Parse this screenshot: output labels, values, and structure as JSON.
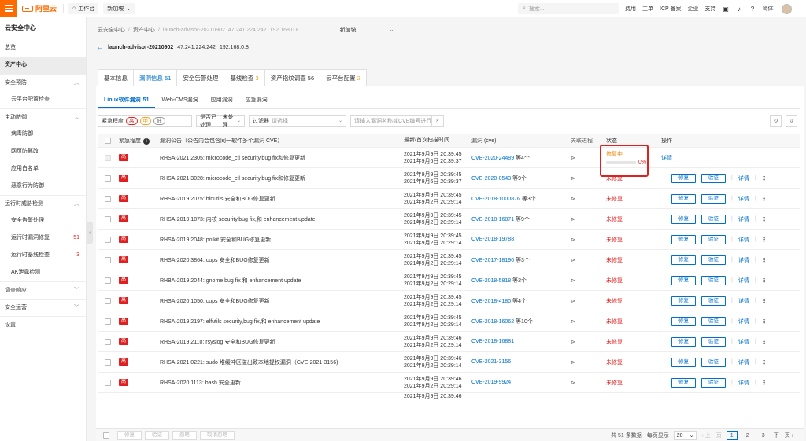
{
  "topbar": {
    "brand": "阿里云",
    "workbench": "工作台",
    "org": "新加坡",
    "search_placeholder": "搜索...",
    "links": [
      "费用",
      "工单",
      "ICP 备案",
      "企业",
      "支持"
    ],
    "lang": "简体"
  },
  "sidebar": {
    "title": "云安全中心",
    "items": [
      {
        "label": "总览",
        "type": "item"
      },
      {
        "label": "资产中心",
        "type": "active"
      },
      {
        "label": "安全预防",
        "type": "group"
      },
      {
        "label": "云平台配置检查",
        "type": "sub"
      },
      {
        "label": "主动防御",
        "type": "group"
      },
      {
        "label": "病毒防御",
        "type": "sub"
      },
      {
        "label": "网页防篡改",
        "type": "sub"
      },
      {
        "label": "应用白名单",
        "type": "sub"
      },
      {
        "label": "恶意行为防御",
        "type": "sub"
      },
      {
        "label": "运行时威胁检测",
        "type": "group"
      },
      {
        "label": "安全告警处理",
        "type": "sub"
      },
      {
        "label": "运行时漏洞修复",
        "type": "sub",
        "count": "51"
      },
      {
        "label": "运行时基线检查",
        "type": "sub",
        "count": "3"
      },
      {
        "label": "AK泄露检测",
        "type": "sub"
      },
      {
        "label": "调查响应",
        "type": "group"
      },
      {
        "label": "安全运营",
        "type": "group"
      },
      {
        "label": "设置",
        "type": "item"
      }
    ]
  },
  "breadcrumb": {
    "items": [
      "云安全中心",
      "/",
      "资产中心",
      "/"
    ],
    "asset": "launch-advisor-20210902",
    "ip1": "47.241.224.242",
    "ip2": "192.168.0.8",
    "region": "新加坡"
  },
  "asset": {
    "name": "launch-advisor-20210902",
    "public_ip": "47.241.224.242",
    "private_ip": "192.168.0.8"
  },
  "tabs": [
    {
      "label": "基本信息",
      "count": ""
    },
    {
      "label": "漏洞信息",
      "count": "51"
    },
    {
      "label": "安全告警处理",
      "count": ""
    },
    {
      "label": "基线检查",
      "count": "3"
    },
    {
      "label": "资产指纹调查",
      "count": "56"
    },
    {
      "label": "云平台配置",
      "count": "2"
    }
  ],
  "subtabs": [
    {
      "label": "Linux软件漏洞",
      "count": "51"
    },
    {
      "label": "Web-CMS漏洞",
      "count": ""
    },
    {
      "label": "应用漏洞",
      "count": ""
    },
    {
      "label": "应急漏洞",
      "count": ""
    }
  ],
  "filters": {
    "severity_label": "紧急程度",
    "sev_high": "高",
    "sev_mid": "中",
    "sev_low": "低",
    "handled_label": "是否已处理",
    "handled_value": "未处理",
    "filter_label": "过滤器",
    "filter_placeholder": "请选择",
    "search_placeholder": "请输入漏洞名称或CVE编号进行搜索"
  },
  "table": {
    "headers": {
      "severity": "紧急程度",
      "name": "漏洞公告（公告内会包含同一软件多个漏洞 CVE）",
      "time": "最新/首次扫描时间",
      "cve": "漏洞 (cve)",
      "related": "关联进程",
      "status": "状态",
      "ops": "操作"
    },
    "rows": [
      {
        "sev": "高",
        "name": "RHSA-2021:2305: microcode_ctl security,bug fix和修复更新",
        "t1": "2021年9月9日 20:39:45",
        "t2": "2021年9月6日 20:39:37",
        "cve": "CVE-2020-24489",
        "more": "等4个",
        "status": "修复中",
        "progress": "0%",
        "disabled": true
      },
      {
        "sev": "高",
        "name": "RHSA-2021:3028: microcode_ctl security,bug fix和修复更新",
        "t1": "2021年9月9日 20:39:45",
        "t2": "2021年9月6日 20:39:37",
        "cve": "CVE-2020-0543",
        "more": "等9个",
        "status": "未修复"
      },
      {
        "sev": "高",
        "name": "RHSA-2019:2075: binutils 安全和BUG修复更新",
        "t1": "2021年9月9日 20:39:45",
        "t2": "2021年9月2日 20:29:14",
        "cve": "CVE-2018-1000876",
        "more": "等3个",
        "status": "未修复"
      },
      {
        "sev": "高",
        "name": "RHSA-2019:1873: 内核 security,bug fix,和 enhancement update",
        "t1": "2021年9月9日 20:39:45",
        "t2": "2021年9月2日 20:29:14",
        "cve": "CVE-2018-16871",
        "more": "等9个",
        "status": "未修复"
      },
      {
        "sev": "高",
        "name": "RHSA-2019:2048: polkit 安全和BUG修复更新",
        "t1": "2021年9月9日 20:39:45",
        "t2": "2021年9月2日 20:29:14",
        "cve": "CVE-2018-19788",
        "more": "",
        "status": "未修复"
      },
      {
        "sev": "高",
        "name": "RHSA-2020:3864: cups 安全和BUG修复更新",
        "t1": "2021年9月9日 20:39:45",
        "t2": "2021年9月2日 20:29:14",
        "cve": "CVE-2017-18190",
        "more": "等3个",
        "status": "未修复"
      },
      {
        "sev": "高",
        "name": "RHBA-2019:2044: gnome bug fix 和 enhancement update",
        "t1": "2021年9月9日 20:39:45",
        "t2": "2021年9月2日 20:29:14",
        "cve": "CVE-2018-5818",
        "more": "等2个",
        "status": "未修复"
      },
      {
        "sev": "高",
        "name": "RHSA-2020:1050: cups 安全和BUG修复更新",
        "t1": "2021年9月9日 20:39:45",
        "t2": "2021年9月2日 20:29:14",
        "cve": "CVE-2018-4180",
        "more": "等4个",
        "status": "未修复"
      },
      {
        "sev": "高",
        "name": "RHSA-2019:2197: elfutils security,bug fix,和 enhancement update",
        "t1": "2021年9月9日 20:39:45",
        "t2": "2021年9月2日 20:29:14",
        "cve": "CVE-2018-16062",
        "more": "等10个",
        "status": "未修复"
      },
      {
        "sev": "高",
        "name": "RHSA-2019:2110: rsyslog 安全和BUG修复更新",
        "t1": "2021年9月9日 20:39:46",
        "t2": "2021年9月2日 20:29:14",
        "cve": "CVE-2018-16881",
        "more": "",
        "status": "未修复"
      },
      {
        "sev": "高",
        "name": "RHSA-2021:0221: sudo 堆缓冲区溢出致本地提权漏洞（CVE-2021-3156)",
        "t1": "2021年9月9日 20:39:46",
        "t2": "2021年9月2日 20:29:14",
        "cve": "CVE-2021-3156",
        "more": "",
        "status": "未修复"
      },
      {
        "sev": "高",
        "name": "RHSA-2020:1113: bash 安全更新",
        "t1": "2021年9月9日 20:39:46",
        "t2": "2021年9月2日 20:29:14",
        "cve": "CVE-2019-9924",
        "more": "",
        "status": "未修复"
      }
    ],
    "partial_time": "2021年9月9日 20:39:46",
    "actions": {
      "fix": "修复",
      "verify": "验证",
      "details": "详情"
    }
  },
  "footer": {
    "buttons": [
      "修复",
      "验证",
      "忽略",
      "取消忽略"
    ],
    "total": "共 51 条数据",
    "per_page_label": "每页显示",
    "per_page": "20",
    "prev": "上一页",
    "pages": [
      "1",
      "2",
      "3"
    ],
    "next": "下一页"
  }
}
